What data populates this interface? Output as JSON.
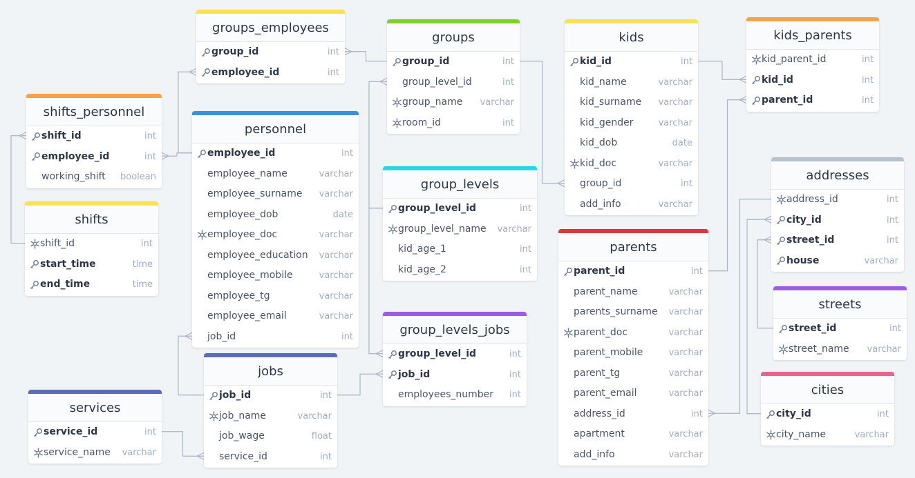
{
  "tables": [
    {
      "name": "groups_employees",
      "color": "#f9e251",
      "columns": [
        {
          "name": "group_id",
          "type": "int",
          "key": "pk"
        },
        {
          "name": "employee_id",
          "type": "int",
          "key": "pk"
        }
      ]
    },
    {
      "name": "groups",
      "color": "#7ed321",
      "columns": [
        {
          "name": "group_id",
          "type": "int",
          "key": "pk"
        },
        {
          "name": "group_level_id",
          "type": "int",
          "key": ""
        },
        {
          "name": "group_name",
          "type": "varchar",
          "key": "unique"
        },
        {
          "name": "room_id",
          "type": "int",
          "key": "unique"
        }
      ]
    },
    {
      "name": "kids",
      "color": "#f9e251",
      "columns": [
        {
          "name": "kid_id",
          "type": "int",
          "key": "pk"
        },
        {
          "name": "kid_name",
          "type": "varchar",
          "key": ""
        },
        {
          "name": "kid_surname",
          "type": "varchar",
          "key": ""
        },
        {
          "name": "kid_gender",
          "type": "varchar",
          "key": ""
        },
        {
          "name": "kid_dob",
          "type": "date",
          "key": ""
        },
        {
          "name": "kid_doc",
          "type": "varchar",
          "key": "unique"
        },
        {
          "name": "group_id",
          "type": "int",
          "key": ""
        },
        {
          "name": "add_info",
          "type": "varchar",
          "key": ""
        }
      ]
    },
    {
      "name": "kids_parents",
      "color": "#f5a34a",
      "columns": [
        {
          "name": "kid_parent_id",
          "type": "int",
          "key": "unique"
        },
        {
          "name": "kid_id",
          "type": "int",
          "key": "pk"
        },
        {
          "name": "parent_id",
          "type": "int",
          "key": "pk"
        }
      ]
    },
    {
      "name": "shifts_personnel",
      "color": "#f5a34a",
      "columns": [
        {
          "name": "shift_id",
          "type": "int",
          "key": "pk"
        },
        {
          "name": "employee_id",
          "type": "int",
          "key": "pk"
        },
        {
          "name": "working_shift",
          "type": "boolean",
          "key": ""
        }
      ]
    },
    {
      "name": "personnel",
      "color": "#3d8fd9",
      "columns": [
        {
          "name": "employee_id",
          "type": "int",
          "key": "pk"
        },
        {
          "name": "employee_name",
          "type": "varchar",
          "key": ""
        },
        {
          "name": "employee_surname",
          "type": "varchar",
          "key": ""
        },
        {
          "name": "employee_dob",
          "type": "date",
          "key": ""
        },
        {
          "name": "employee_doc",
          "type": "varchar",
          "key": "unique"
        },
        {
          "name": "employee_education",
          "type": "varchar",
          "key": ""
        },
        {
          "name": "employee_mobile",
          "type": "varchar",
          "key": ""
        },
        {
          "name": "employee_tg",
          "type": "varchar",
          "key": ""
        },
        {
          "name": "employee_email",
          "type": "varchar",
          "key": ""
        },
        {
          "name": "job_id",
          "type": "int",
          "key": ""
        }
      ]
    },
    {
      "name": "shifts",
      "color": "#f9e251",
      "columns": [
        {
          "name": "shift_id",
          "type": "int",
          "key": "unique"
        },
        {
          "name": "start_time",
          "type": "time",
          "key": "pk"
        },
        {
          "name": "end_time",
          "type": "time",
          "key": "pk"
        }
      ]
    },
    {
      "name": "group_levels",
      "color": "#2ed1e8",
      "columns": [
        {
          "name": "group_level_id",
          "type": "int",
          "key": "pk"
        },
        {
          "name": "group_level_name",
          "type": "varchar",
          "key": "unique"
        },
        {
          "name": "kid_age_1",
          "type": "int",
          "key": ""
        },
        {
          "name": "kid_age_2",
          "type": "int",
          "key": ""
        }
      ]
    },
    {
      "name": "addresses",
      "color": "#b8c2cc",
      "columns": [
        {
          "name": "address_id",
          "type": "int",
          "key": "unique"
        },
        {
          "name": "city_id",
          "type": "int",
          "key": "pk"
        },
        {
          "name": "street_id",
          "type": "int",
          "key": "pk"
        },
        {
          "name": "house",
          "type": "varchar",
          "key": "pk"
        }
      ]
    },
    {
      "name": "parents",
      "color": "#d63b3b",
      "columns": [
        {
          "name": "parent_id",
          "type": "int",
          "key": "pk"
        },
        {
          "name": "parent_name",
          "type": "varchar",
          "key": ""
        },
        {
          "name": "parents_surname",
          "type": "varchar",
          "key": ""
        },
        {
          "name": "parent_doc",
          "type": "varchar",
          "key": "unique"
        },
        {
          "name": "parent_mobile",
          "type": "varchar",
          "key": ""
        },
        {
          "name": "parent_tg",
          "type": "varchar",
          "key": ""
        },
        {
          "name": "parent_email",
          "type": "varchar",
          "key": ""
        },
        {
          "name": "address_id",
          "type": "int",
          "key": ""
        },
        {
          "name": "apartment",
          "type": "varchar",
          "key": ""
        },
        {
          "name": "add_info",
          "type": "varchar",
          "key": ""
        }
      ]
    },
    {
      "name": "streets",
      "color": "#9b5de5",
      "columns": [
        {
          "name": "street_id",
          "type": "int",
          "key": "pk"
        },
        {
          "name": "street_name",
          "type": "varchar",
          "key": "unique"
        }
      ]
    },
    {
      "name": "group_levels_jobs",
      "color": "#9b5de5",
      "columns": [
        {
          "name": "group_level_id",
          "type": "int",
          "key": "pk"
        },
        {
          "name": "job_id",
          "type": "int",
          "key": "pk"
        },
        {
          "name": "employees_number",
          "type": "int",
          "key": ""
        }
      ]
    },
    {
      "name": "jobs",
      "color": "#5c6bc0",
      "columns": [
        {
          "name": "job_id",
          "type": "int",
          "key": "pk"
        },
        {
          "name": "job_name",
          "type": "varchar",
          "key": "unique"
        },
        {
          "name": "job_wage",
          "type": "float",
          "key": ""
        },
        {
          "name": "service_id",
          "type": "int",
          "key": ""
        }
      ]
    },
    {
      "name": "services",
      "color": "#5c6bc0",
      "columns": [
        {
          "name": "service_id",
          "type": "int",
          "key": "pk"
        },
        {
          "name": "service_name",
          "type": "varchar",
          "key": "unique"
        }
      ]
    },
    {
      "name": "cities",
      "color": "#e8638c",
      "columns": [
        {
          "name": "city_id",
          "type": "int",
          "key": "pk"
        },
        {
          "name": "city_name",
          "type": "varchar",
          "key": "unique"
        }
      ]
    }
  ],
  "relationships": [
    {
      "from": "groups_employees.group_id",
      "to": "groups.group_id"
    },
    {
      "from": "groups_employees.employee_id",
      "to": "personnel.employee_id"
    },
    {
      "from": "shifts_personnel.employee_id",
      "to": "personnel.employee_id"
    },
    {
      "from": "shifts_personnel.shift_id",
      "to": "shifts.shift_id"
    },
    {
      "from": "groups.group_level_id",
      "to": "group_levels.group_level_id"
    },
    {
      "from": "kids.group_id",
      "to": "groups.group_id"
    },
    {
      "from": "kids_parents.kid_id",
      "to": "kids.kid_id"
    },
    {
      "from": "kids_parents.parent_id",
      "to": "parents.parent_id"
    },
    {
      "from": "group_levels_jobs.group_level_id",
      "to": "group_levels.group_level_id"
    },
    {
      "from": "group_levels_jobs.job_id",
      "to": "jobs.job_id"
    },
    {
      "from": "personnel.job_id",
      "to": "jobs.job_id"
    },
    {
      "from": "jobs.service_id",
      "to": "services.service_id"
    },
    {
      "from": "parents.address_id",
      "to": "addresses.address_id"
    },
    {
      "from": "addresses.city_id",
      "to": "cities.city_id"
    },
    {
      "from": "addresses.street_id",
      "to": "streets.street_id"
    }
  ]
}
